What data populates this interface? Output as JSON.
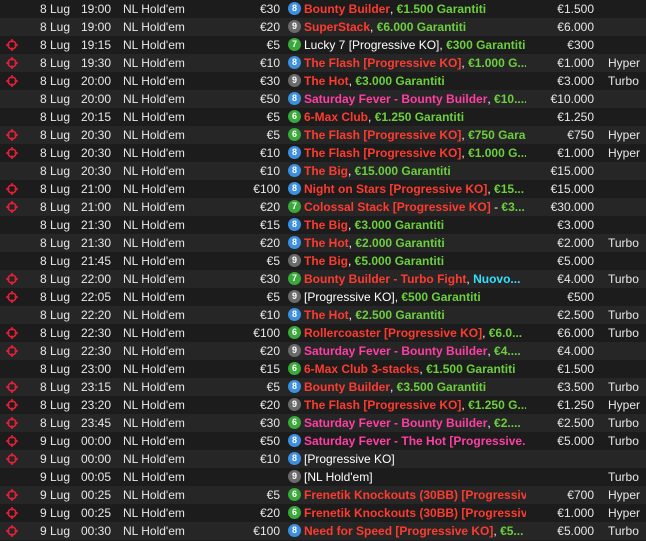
{
  "colors": {
    "row_alt": "#262626",
    "background": "#1c1c1c",
    "title_red": "#ff3b30",
    "title_pink": "#ff3fa4",
    "guarantee_green": "#6ccf3d",
    "new_cyan": "#33e0ff",
    "badge_blue": "#3d8fe0",
    "badge_green": "#3aa83a",
    "badge_gray": "#6a6a6a",
    "crosshair_red": "#e8203a"
  },
  "rows": [
    {
      "icon": "none",
      "date": "8 Lug",
      "time": "19:00",
      "game": "NL Hold'em",
      "buyin": "€30",
      "badge": "8",
      "badge_color": "blue",
      "name_parts": [
        {
          "text": "Bounty Builder",
          "style": "red"
        },
        {
          "text": ", ",
          "style": "white"
        },
        {
          "text": "€1.500 Garantiti",
          "style": "green"
        }
      ],
      "prize": "€1.500",
      "type": ""
    },
    {
      "icon": "none",
      "date": "8 Lug",
      "time": "19:00",
      "game": "NL Hold'em",
      "buyin": "€20",
      "badge": "9",
      "badge_color": "gray",
      "name_parts": [
        {
          "text": "SuperStack",
          "style": "red"
        },
        {
          "text": ", ",
          "style": "white"
        },
        {
          "text": "€6.000 Garantiti",
          "style": "green"
        }
      ],
      "prize": "€6.000",
      "type": ""
    },
    {
      "icon": "crosshair",
      "date": "8 Lug",
      "time": "19:15",
      "game": "NL Hold'em",
      "buyin": "€5",
      "badge": "7",
      "badge_color": "green",
      "name_parts": [
        {
          "text": "Lucky 7 [Progressive KO]",
          "style": "white"
        },
        {
          "text": ", ",
          "style": "white"
        },
        {
          "text": "€300 Garantiti",
          "style": "green"
        }
      ],
      "prize": "€300",
      "type": ""
    },
    {
      "icon": "crosshair",
      "date": "8 Lug",
      "time": "19:30",
      "game": "NL Hold'em",
      "buyin": "€10",
      "badge": "8",
      "badge_color": "blue",
      "name_parts": [
        {
          "text": "The Flash [Progressive KO]",
          "style": "red"
        },
        {
          "text": ", ",
          "style": "white"
        },
        {
          "text": "€1.000 G...",
          "style": "green"
        }
      ],
      "prize": "€1.000",
      "type": "Hyper"
    },
    {
      "icon": "crosshair",
      "date": "8 Lug",
      "time": "20:00",
      "game": "NL Hold'em",
      "buyin": "€30",
      "badge": "9",
      "badge_color": "gray",
      "name_parts": [
        {
          "text": "The Hot",
          "style": "red"
        },
        {
          "text": ", ",
          "style": "white"
        },
        {
          "text": "€3.000 Garantiti",
          "style": "green"
        }
      ],
      "prize": "€3.000",
      "type": "Turbo"
    },
    {
      "icon": "none",
      "date": "8 Lug",
      "time": "20:00",
      "game": "NL Hold'em",
      "buyin": "€50",
      "badge": "8",
      "badge_color": "blue",
      "name_parts": [
        {
          "text": "Saturday Fever - Bounty Builder",
          "style": "pink"
        },
        {
          "text": ", ",
          "style": "white"
        },
        {
          "text": "€10....",
          "style": "green"
        }
      ],
      "prize": "€10.000",
      "type": ""
    },
    {
      "icon": "none",
      "date": "8 Lug",
      "time": "20:15",
      "game": "NL Hold'em",
      "buyin": "€5",
      "badge": "6",
      "badge_color": "green",
      "name_parts": [
        {
          "text": "6-Max Club",
          "style": "red"
        },
        {
          "text": ", ",
          "style": "white"
        },
        {
          "text": "€1.250 Garantiti",
          "style": "green"
        }
      ],
      "prize": "€1.250",
      "type": ""
    },
    {
      "icon": "crosshair",
      "date": "8 Lug",
      "time": "20:30",
      "game": "NL Hold'em",
      "buyin": "€5",
      "badge": "6",
      "badge_color": "green",
      "name_parts": [
        {
          "text": "The Flash [Progressive KO]",
          "style": "red"
        },
        {
          "text": ", ",
          "style": "white"
        },
        {
          "text": "€750 Gara...",
          "style": "green"
        }
      ],
      "prize": "€750",
      "type": "Hyper"
    },
    {
      "icon": "crosshair",
      "date": "8 Lug",
      "time": "20:30",
      "game": "NL Hold'em",
      "buyin": "€10",
      "badge": "8",
      "badge_color": "blue",
      "name_parts": [
        {
          "text": "The Flash [Progressive KO]",
          "style": "red"
        },
        {
          "text": ", ",
          "style": "white"
        },
        {
          "text": "€1.000 G...",
          "style": "green"
        }
      ],
      "prize": "€1.000",
      "type": "Hyper"
    },
    {
      "icon": "none",
      "date": "8 Lug",
      "time": "20:30",
      "game": "NL Hold'em",
      "buyin": "€10",
      "badge": "8",
      "badge_color": "blue",
      "name_parts": [
        {
          "text": "The Big",
          "style": "red"
        },
        {
          "text": ", ",
          "style": "white"
        },
        {
          "text": "€15.000 Garantiti",
          "style": "green"
        }
      ],
      "prize": "€15.000",
      "type": ""
    },
    {
      "icon": "crosshair",
      "date": "8 Lug",
      "time": "21:00",
      "game": "NL Hold'em",
      "buyin": "€100",
      "badge": "8",
      "badge_color": "blue",
      "name_parts": [
        {
          "text": "Night on Stars [Progressive KO]",
          "style": "red"
        },
        {
          "text": ", ",
          "style": "white"
        },
        {
          "text": "€15...",
          "style": "green"
        }
      ],
      "prize": "€15.000",
      "type": ""
    },
    {
      "icon": "crosshair",
      "date": "8 Lug",
      "time": "21:00",
      "game": "NL Hold'em",
      "buyin": "€20",
      "badge": "7",
      "badge_color": "green",
      "name_parts": [
        {
          "text": "Colossal Stack [Progressive KO]",
          "style": "red"
        },
        {
          "text": " - ",
          "style": "white"
        },
        {
          "text": "€3...",
          "style": "green"
        }
      ],
      "prize": "€30.000",
      "type": ""
    },
    {
      "icon": "none",
      "date": "8 Lug",
      "time": "21:30",
      "game": "NL Hold'em",
      "buyin": "€15",
      "badge": "8",
      "badge_color": "blue",
      "name_parts": [
        {
          "text": "The Big",
          "style": "red"
        },
        {
          "text": ", ",
          "style": "white"
        },
        {
          "text": "€3.000 Garantiti",
          "style": "green"
        }
      ],
      "prize": "€3.000",
      "type": ""
    },
    {
      "icon": "none",
      "date": "8 Lug",
      "time": "21:30",
      "game": "NL Hold'em",
      "buyin": "€20",
      "badge": "8",
      "badge_color": "blue",
      "name_parts": [
        {
          "text": "The Hot",
          "style": "red"
        },
        {
          "text": ", ",
          "style": "white"
        },
        {
          "text": "€2.000 Garantiti",
          "style": "green"
        }
      ],
      "prize": "€2.000",
      "type": "Turbo"
    },
    {
      "icon": "none",
      "date": "8 Lug",
      "time": "21:45",
      "game": "NL Hold'em",
      "buyin": "€5",
      "badge": "9",
      "badge_color": "gray",
      "name_parts": [
        {
          "text": "The Big",
          "style": "red"
        },
        {
          "text": ", ",
          "style": "white"
        },
        {
          "text": "€5.000 Garantiti",
          "style": "green"
        }
      ],
      "prize": "€5.000",
      "type": ""
    },
    {
      "icon": "crosshair",
      "date": "8 Lug",
      "time": "22:00",
      "game": "NL Hold'em",
      "buyin": "€30",
      "badge": "7",
      "badge_color": "green",
      "name_parts": [
        {
          "text": "Bounty Builder - Turbo Fight",
          "style": "red"
        },
        {
          "text": ", ",
          "style": "white"
        },
        {
          "text": "Nuovo...",
          "style": "cyan"
        }
      ],
      "prize": "€4.000",
      "type": "Turbo"
    },
    {
      "icon": "crosshair",
      "date": "8 Lug",
      "time": "22:05",
      "game": "NL Hold'em",
      "buyin": "€5",
      "badge": "9",
      "badge_color": "gray",
      "name_parts": [
        {
          "text": "[Progressive KO]",
          "style": "white"
        },
        {
          "text": ", ",
          "style": "white"
        },
        {
          "text": "€500 Garantiti",
          "style": "green"
        }
      ],
      "prize": "€500",
      "type": ""
    },
    {
      "icon": "none",
      "date": "8 Lug",
      "time": "22:20",
      "game": "NL Hold'em",
      "buyin": "€10",
      "badge": "8",
      "badge_color": "blue",
      "name_parts": [
        {
          "text": "The Hot",
          "style": "red"
        },
        {
          "text": ", ",
          "style": "white"
        },
        {
          "text": "€2.500 Garantiti",
          "style": "green"
        }
      ],
      "prize": "€2.500",
      "type": "Turbo"
    },
    {
      "icon": "crosshair",
      "date": "8 Lug",
      "time": "22:30",
      "game": "NL Hold'em",
      "buyin": "€100",
      "badge": "6",
      "badge_color": "green",
      "name_parts": [
        {
          "text": "Rollercoaster [Progressive KO]",
          "style": "red"
        },
        {
          "text": ", ",
          "style": "white"
        },
        {
          "text": "€6.0...",
          "style": "green"
        }
      ],
      "prize": "€6.000",
      "type": "Turbo"
    },
    {
      "icon": "crosshair",
      "date": "8 Lug",
      "time": "22:30",
      "game": "NL Hold'em",
      "buyin": "€20",
      "badge": "9",
      "badge_color": "gray",
      "name_parts": [
        {
          "text": "Saturday Fever - Bounty Builder",
          "style": "pink"
        },
        {
          "text": ", ",
          "style": "white"
        },
        {
          "text": "€4....",
          "style": "green"
        }
      ],
      "prize": "€4.000",
      "type": ""
    },
    {
      "icon": "none",
      "date": "8 Lug",
      "time": "23:00",
      "game": "NL Hold'em",
      "buyin": "€15",
      "badge": "6",
      "badge_color": "green",
      "name_parts": [
        {
          "text": "6-Max Club 3-stacks",
          "style": "red"
        },
        {
          "text": ", ",
          "style": "white"
        },
        {
          "text": "€1.500 Garantiti",
          "style": "green"
        }
      ],
      "prize": "€1.500",
      "type": ""
    },
    {
      "icon": "crosshair",
      "date": "8 Lug",
      "time": "23:15",
      "game": "NL Hold'em",
      "buyin": "€5",
      "badge": "8",
      "badge_color": "blue",
      "name_parts": [
        {
          "text": "Bounty Builder",
          "style": "red"
        },
        {
          "text": ", ",
          "style": "white"
        },
        {
          "text": "€3.500 Garantiti",
          "style": "green"
        }
      ],
      "prize": "€3.500",
      "type": "Turbo"
    },
    {
      "icon": "crosshair",
      "date": "8 Lug",
      "time": "23:20",
      "game": "NL Hold'em",
      "buyin": "€20",
      "badge": "9",
      "badge_color": "gray",
      "name_parts": [
        {
          "text": "The Flash [Progressive KO]",
          "style": "red"
        },
        {
          "text": ", ",
          "style": "white"
        },
        {
          "text": "€1.250 G...",
          "style": "green"
        }
      ],
      "prize": "€1.250",
      "type": "Hyper"
    },
    {
      "icon": "crosshair",
      "date": "8 Lug",
      "time": "23:45",
      "game": "NL Hold'em",
      "buyin": "€30",
      "badge": "6",
      "badge_color": "green",
      "name_parts": [
        {
          "text": "Saturday Fever - Bounty Builder",
          "style": "pink"
        },
        {
          "text": ", ",
          "style": "white"
        },
        {
          "text": "€2....",
          "style": "green"
        }
      ],
      "prize": "€2.500",
      "type": "Turbo"
    },
    {
      "icon": "crosshair",
      "date": "9 Lug",
      "time": "00:00",
      "game": "NL Hold'em",
      "buyin": "€50",
      "badge": "8",
      "badge_color": "blue",
      "name_parts": [
        {
          "text": "Saturday Fever - The Hot [Progressive...",
          "style": "pink"
        }
      ],
      "prize": "€5.000",
      "type": "Turbo"
    },
    {
      "icon": "crosshair",
      "date": "9 Lug",
      "time": "00:00",
      "game": "NL Hold'em",
      "buyin": "€10",
      "badge": "8",
      "badge_color": "blue",
      "name_parts": [
        {
          "text": "[Progressive KO]",
          "style": "white"
        }
      ],
      "prize": "",
      "type": ""
    },
    {
      "icon": "none",
      "date": "9 Lug",
      "time": "00:05",
      "game": "NL Hold'em",
      "buyin": "",
      "badge": "9",
      "badge_color": "gray",
      "name_parts": [
        {
          "text": "[NL Hold'em]",
          "style": "white"
        }
      ],
      "prize": "",
      "type": "Turbo"
    },
    {
      "icon": "crosshair",
      "date": "9 Lug",
      "time": "00:25",
      "game": "NL Hold'em",
      "buyin": "€5",
      "badge": "6",
      "badge_color": "green",
      "name_parts": [
        {
          "text": "Frenetik Knockouts (30BB) [Progressiv...",
          "style": "red"
        }
      ],
      "prize": "€700",
      "type": "Hyper"
    },
    {
      "icon": "crosshair",
      "date": "9 Lug",
      "time": "00:25",
      "game": "NL Hold'em",
      "buyin": "€20",
      "badge": "6",
      "badge_color": "green",
      "name_parts": [
        {
          "text": "Frenetik Knockouts (30BB) [Progressiv...",
          "style": "red"
        }
      ],
      "prize": "€1.000",
      "type": "Hyper"
    },
    {
      "icon": "crosshair",
      "date": "9 Lug",
      "time": "00:30",
      "game": "NL Hold'em",
      "buyin": "€100",
      "badge": "8",
      "badge_color": "blue",
      "name_parts": [
        {
          "text": "Need for Speed [Progressive KO]",
          "style": "red"
        },
        {
          "text": ", ",
          "style": "white"
        },
        {
          "text": "€5...",
          "style": "green"
        }
      ],
      "prize": "€5.000",
      "type": "Turbo"
    }
  ]
}
